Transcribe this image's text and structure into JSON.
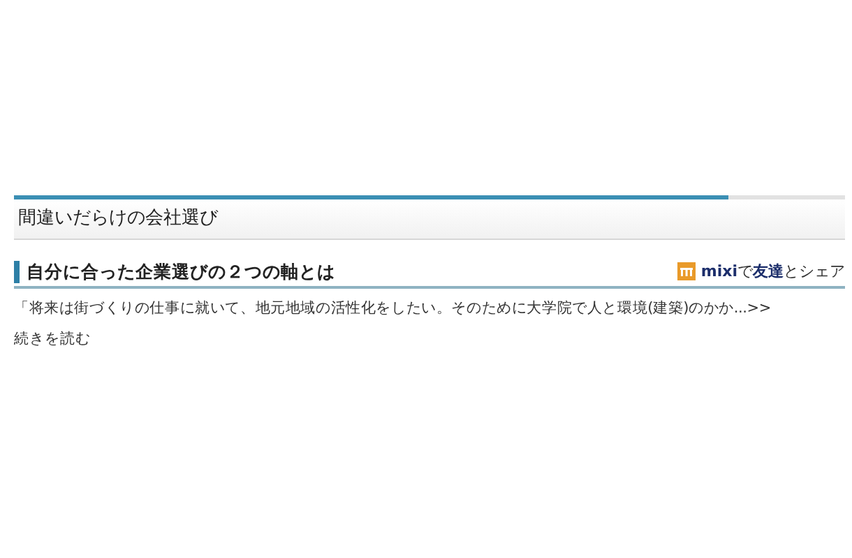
{
  "page_title": "間違いだらけの会社選び",
  "article": {
    "heading": "自分に合った企業選びの２つの軸とは",
    "share_link": "**mixi**で**友達**とシェア",
    "excerpt": "「将来は街づくりの仕事に就いて、地元地域の活性化をしたい。そのために大学院で人と環境(建築)のかか...>>",
    "read_more": "続きを読む"
  }
}
